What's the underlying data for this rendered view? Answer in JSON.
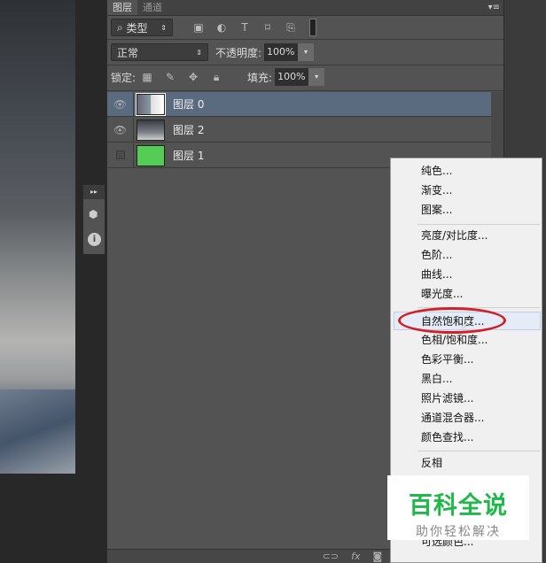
{
  "panel": {
    "tabs": [
      {
        "label": "图层"
      },
      {
        "label": "通道"
      }
    ],
    "filter": {
      "label": "类型",
      "icons": [
        "image-filter-icon",
        "adjustment-filter-icon",
        "type-filter-icon",
        "shape-filter-icon",
        "smart-object-filter-icon",
        "filter-toggle-icon"
      ]
    },
    "blend_mode": "正常",
    "opacity_label": "不透明度:",
    "opacity_value": "100%",
    "lock_label": "锁定:",
    "fill_label": "填充:",
    "fill_value": "100%",
    "layers": [
      {
        "name": "图层 0",
        "visible": true,
        "selected": true
      },
      {
        "name": "图层 2",
        "visible": true,
        "selected": false
      },
      {
        "name": "图层 1",
        "visible": false,
        "selected": false,
        "thumb_color": "#55cc55"
      }
    ],
    "bottom_icons": [
      "link-icon",
      "fx-icon",
      "mask-icon",
      "adjustment-icon",
      "group-icon",
      "new-layer-icon",
      "trash-icon"
    ],
    "fx_label": "fx"
  },
  "menu": {
    "groups": [
      [
        "纯色...",
        "渐变...",
        "图案..."
      ],
      [
        "亮度/对比度...",
        "色阶...",
        "曲线...",
        "曝光度..."
      ],
      [
        "自然饱和度...",
        "色相/饱和度...",
        "色彩平衡...",
        "黑白...",
        "照片滤镜...",
        "通道混合器...",
        "颜色查找..."
      ],
      [
        "反相",
        "可选颜色..."
      ]
    ],
    "highlighted": "自然饱和度..."
  },
  "watermark": {
    "title": "百科全说",
    "subtitle": "助你轻松解决"
  },
  "colors": {
    "highlight_ring": "#d0202a",
    "watermark_green": "#1fb94a",
    "selected_layer": "#5a6b80"
  }
}
